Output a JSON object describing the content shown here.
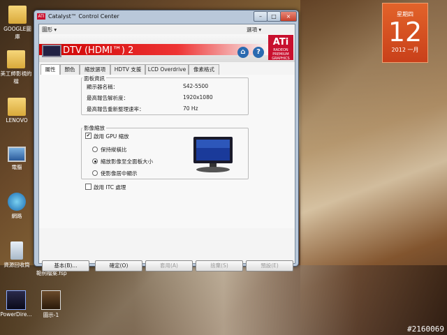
{
  "desktop": {
    "icons": [
      {
        "label": "GOOGLE圖\n庫"
      },
      {
        "label": "美工師影視的\n檔"
      },
      {
        "label": "LENOVO"
      },
      {
        "label": "電腦"
      },
      {
        "label": "網路"
      },
      {
        "label": "資源回收筒"
      },
      {
        "label": "PowerDire..."
      },
      {
        "label": "圖示-1"
      }
    ],
    "partial_label": "範例檔案.fsp",
    "calendar": {
      "weekday": "星期四",
      "day": "12",
      "month": "2012 一月"
    },
    "watermark": "#2160069"
  },
  "window": {
    "title": "Catalyst™ Control Center",
    "title_icon": "ATI",
    "min": "–",
    "max": "□",
    "close": "×",
    "menu": {
      "left": "圖形 ▾",
      "right": "選項 ▾"
    },
    "device_title": "DTV (HDMI™) 2",
    "home_icon": "⌂",
    "help_icon": "?",
    "ati_logo": {
      "big": "ATi",
      "sub": "RADEON",
      "sub2": "PREMIUM GRAPHICS"
    },
    "tabs": [
      "屬性",
      "顏色",
      "縮放選項",
      "HDTV 支援",
      "LCD Overdrive",
      "像素格式"
    ],
    "panel_info": {
      "title": "面板資訊",
      "rows": [
        {
          "label": "顯示器名稱：",
          "value": "S42-5500"
        },
        {
          "label": "最高報告解析度：",
          "value": "1920x1080"
        },
        {
          "label": "最高報告重新整理速率：",
          "value": "70 Hz"
        }
      ]
    },
    "scaling": {
      "title": "影像縮放",
      "enable_gpu": "啟用 GPU 縮放",
      "options": [
        "保持縱橫比",
        "縮放影像至全面板大小",
        "使影像居中顯示"
      ],
      "selected": 1
    },
    "itc": "啟用 ITC 處理",
    "buttons": {
      "basic": "基本(B)...",
      "ok": "確定(O)",
      "apply": "套用(A)",
      "discard": "捨棄(S)",
      "defaults": "預設(E)"
    }
  }
}
